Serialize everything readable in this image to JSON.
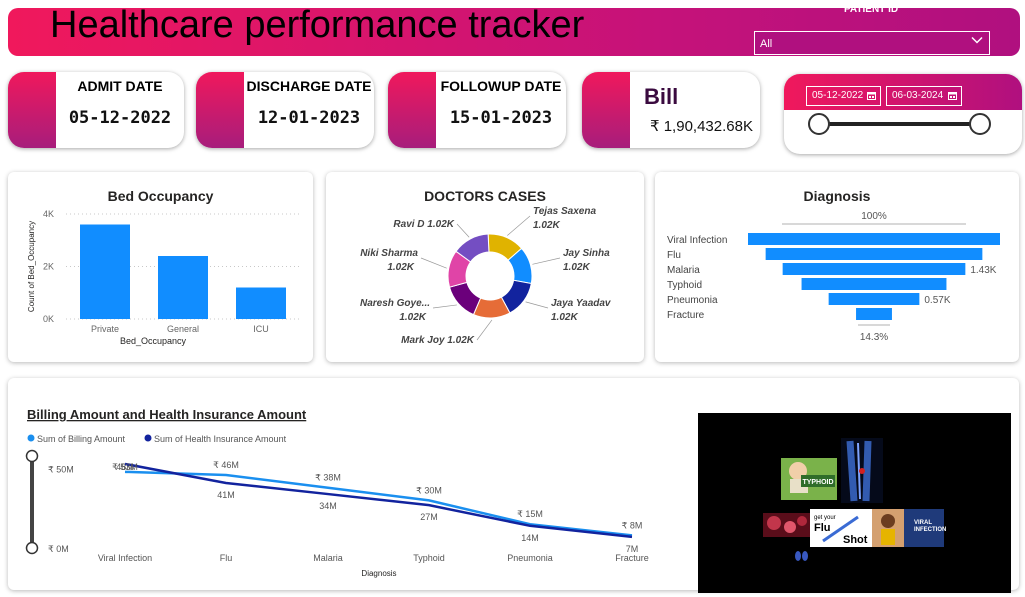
{
  "header": {
    "title": "Healthcare performance tracker",
    "patient_id_label": "PATIENT ID",
    "patient_id_value": "All"
  },
  "kpis": {
    "admit": {
      "label": "ADMIT DATE",
      "value": "05-12-2022"
    },
    "discharge": {
      "label": "DISCHARGE DATE",
      "value": "12-01-2023"
    },
    "followup": {
      "label": "FOLLOWUP DATE",
      "value": "15-01-2023"
    },
    "bill": {
      "label": "Bill",
      "value": "₹ 1,90,432.68K"
    }
  },
  "date_slicer": {
    "start": "05-12-2022",
    "end": "06-03-2024",
    "calendar_icon": "calendar-icon"
  },
  "colors": {
    "accent_pink": "#f0185c",
    "accent_purple": "#b0107f",
    "bar_blue": "#118dff",
    "line_light": "#1a8fef",
    "line_dark": "#12239e"
  },
  "chart_data": [
    {
      "type": "bar",
      "title": "Bed Occupancy",
      "categories": [
        "Private",
        "General",
        "ICU"
      ],
      "values": [
        3600,
        2400,
        1200
      ],
      "xlabel": "Bed_Occupancy",
      "ylabel": "Count of Bed_Occupancy",
      "y_ticks": [
        "0K",
        "2K",
        "4K"
      ],
      "ylim": [
        0,
        4000
      ],
      "grid": true
    },
    {
      "type": "pie",
      "title": "DOCTORS CASES",
      "donut": true,
      "slices": [
        {
          "label": "Tejas Saxena",
          "value": 1020,
          "display": "1.02K",
          "color": "#e0b300"
        },
        {
          "label": "Jay Sinha",
          "value": 1020,
          "display": "1.02K",
          "color": "#118dff"
        },
        {
          "label": "Jaya Yaadav",
          "value": 1020,
          "display": "1.02K",
          "color": "#12239e"
        },
        {
          "label": "Mark Joy",
          "value": 1020,
          "display": "1.02K",
          "color": "#e66c37"
        },
        {
          "label": "Naresh Goye...",
          "value": 1020,
          "display": "1.02K",
          "color": "#6b007b"
        },
        {
          "label": "Niki Sharma",
          "value": 1020,
          "display": "1.02K",
          "color": "#e044a7"
        },
        {
          "label": "Ravi D",
          "value": 1020,
          "display": "1.02K",
          "color": "#744ec2"
        }
      ]
    },
    {
      "type": "bar",
      "subtype": "funnel",
      "title": "Diagnosis",
      "categories": [
        "Viral Infection",
        "Flu",
        "Malaria",
        "Typhoid",
        "Pneumonia",
        "Fracture"
      ],
      "values": [
        4000,
        3440,
        2900,
        2300,
        1440,
        570
      ],
      "data_labels": {
        "Malaria": "1.43K",
        "Pneumonia": "0.57K"
      },
      "top_percent": "100%",
      "bottom_percent": "14.3%"
    },
    {
      "type": "line",
      "title": "Billing Amount and Health Insurance Amount",
      "categories": [
        "Viral Infection",
        "Flu",
        "Malaria",
        "Typhoid",
        "Pneumonia",
        "Fracture"
      ],
      "xlabel": "Diagnosis",
      "y_ticks": [
        "₹ 0M",
        "₹ 50M"
      ],
      "ylim": [
        0,
        58
      ],
      "series": [
        {
          "name": "Sum of Billing Amount",
          "values": [
            48,
            46,
            38,
            30,
            15,
            8
          ],
          "labels": [
            "48M",
            "₹ 46M",
            "₹ 38M",
            "₹ 30M",
            "₹ 15M",
            "₹ 8M"
          ],
          "color": "#1a8fef"
        },
        {
          "name": "Sum of Health Insurance Amount",
          "values": [
            53,
            41,
            34,
            27,
            14,
            7
          ],
          "labels": [
            "₹ 53M",
            "41M",
            "34M",
            "27M",
            "14M",
            "7M"
          ],
          "color": "#12239e"
        }
      ]
    }
  ],
  "media": {
    "typhoid_tile": "TYPHOID",
    "flu_shot_tile": [
      "get your",
      "Flu",
      "Shot"
    ],
    "viral_tile": [
      "VIRAL",
      "INFECTION"
    ]
  }
}
